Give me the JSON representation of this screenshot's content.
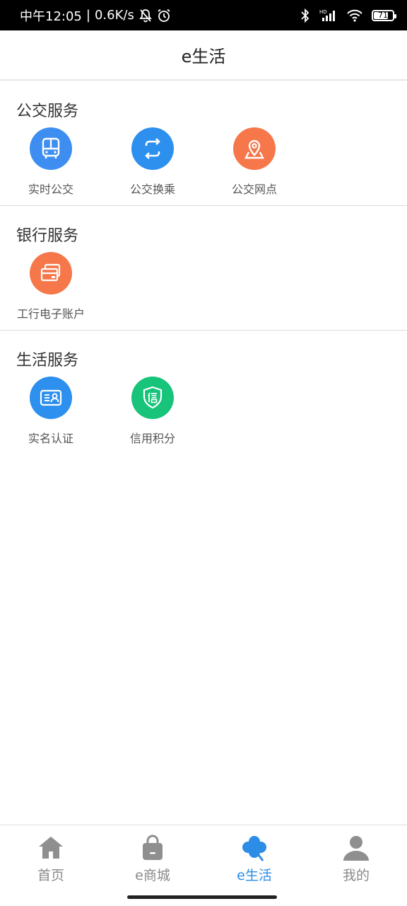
{
  "status_bar": {
    "time": "中午12:05",
    "separator": "|",
    "net_speed": "0.6K/s",
    "battery": "71",
    "icons": [
      "bell-off-icon",
      "alarm-icon",
      "bluetooth-icon",
      "hd-signal-icon",
      "wifi-icon",
      "battery-icon"
    ]
  },
  "header": {
    "title": "e生活"
  },
  "sections": [
    {
      "title": "公交服务",
      "items": [
        {
          "label": "实时公交",
          "icon": "bus-icon",
          "color": "#3d8ef0"
        },
        {
          "label": "公交换乘",
          "icon": "transfer-icon",
          "color": "#2d8fee"
        },
        {
          "label": "公交网点",
          "icon": "map-pin-icon",
          "color": "#f5774a"
        }
      ]
    },
    {
      "title": "银行服务",
      "items": [
        {
          "label": "工行电子账户",
          "icon": "bank-card-icon",
          "color": "#f5774a"
        }
      ]
    },
    {
      "title": "生活服务",
      "items": [
        {
          "label": "实名认证",
          "icon": "id-card-icon",
          "color": "#2d8fee"
        },
        {
          "label": "信用积分",
          "icon": "credit-shield-icon",
          "color": "#18c37a"
        }
      ]
    }
  ],
  "bottom_nav": {
    "items": [
      {
        "label": "首页",
        "icon": "home-icon"
      },
      {
        "label": "e商城",
        "icon": "shopping-bag-icon"
      },
      {
        "label": "e生活",
        "icon": "clover-icon",
        "active": true
      },
      {
        "label": "我的",
        "icon": "user-icon"
      }
    ],
    "active_color": "#2b8de6",
    "inactive_color": "#8a8a8a"
  }
}
